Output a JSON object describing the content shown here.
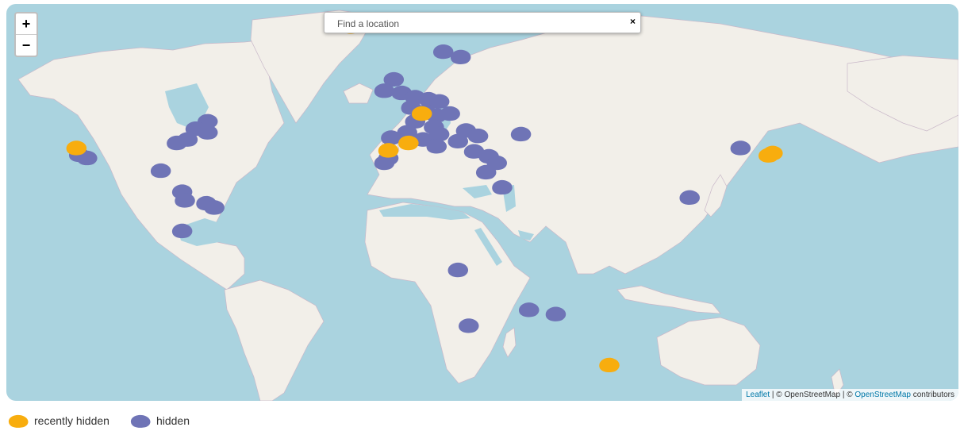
{
  "map": {
    "zoom_in_label": "+",
    "zoom_out_label": "−",
    "search": {
      "placeholder": "Find a location",
      "value": "",
      "clear_label": "×"
    },
    "attribution": {
      "leaflet": "Leaflet",
      "sep1": " | © OpenStreetMap | © ",
      "osm": "OpenStreetMap",
      "suffix": " contributors"
    },
    "colors": {
      "water": "#aad3df",
      "land": "#f2efe9",
      "recent": "#f8ad0e",
      "hidden": "#6f74b6"
    }
  },
  "legend": [
    {
      "label": "recently hidden",
      "color": "#f8ad0e",
      "icon": "blob-icon"
    },
    {
      "label": "hidden",
      "color": "#6f74b6",
      "icon": "blob-icon"
    }
  ],
  "markers": {
    "recent": [
      {
        "lat": 64.8,
        "lon": -19.0
      },
      {
        "lat": 37.5,
        "lon": -121.5
      },
      {
        "lat": 36.8,
        "lon": -5.0
      },
      {
        "lat": 39.0,
        "lon": 2.5
      },
      {
        "lat": 36.0,
        "lon": 138.5
      },
      {
        "lat": 35.3,
        "lon": 137.0
      },
      {
        "lat": -37.5,
        "lon": 77.5
      },
      {
        "lat": 47.0,
        "lon": 7.5
      }
    ],
    "hidden": [
      {
        "lat": 69.3,
        "lon": 22.5
      },
      {
        "lat": 70.5,
        "lon": 27.0
      },
      {
        "lat": 68.6,
        "lon": 19.0
      },
      {
        "lat": 60.5,
        "lon": 15.5
      },
      {
        "lat": 59.5,
        "lon": 22.0
      },
      {
        "lat": 55.0,
        "lon": -3.0
      },
      {
        "lat": 52.5,
        "lon": -6.5
      },
      {
        "lat": 52.0,
        "lon": 0.0
      },
      {
        "lat": 51.0,
        "lon": 5.0
      },
      {
        "lat": 50.5,
        "lon": 10.0
      },
      {
        "lat": 50.0,
        "lon": 14.0
      },
      {
        "lat": 48.5,
        "lon": 3.5
      },
      {
        "lat": 47.5,
        "lon": 9.0
      },
      {
        "lat": 46.5,
        "lon": 13.0
      },
      {
        "lat": 47.0,
        "lon": 18.0
      },
      {
        "lat": 45.0,
        "lon": 5.0
      },
      {
        "lat": 43.5,
        "lon": 12.0
      },
      {
        "lat": 42.0,
        "lon": 2.0
      },
      {
        "lat": 40.5,
        "lon": -4.0
      },
      {
        "lat": 40.0,
        "lon": 8.0
      },
      {
        "lat": 41.5,
        "lon": 14.0
      },
      {
        "lat": 38.0,
        "lon": 13.0
      },
      {
        "lat": 39.5,
        "lon": 21.0
      },
      {
        "lat": 42.5,
        "lon": 24.0
      },
      {
        "lat": 41.0,
        "lon": 28.5
      },
      {
        "lat": 41.5,
        "lon": 44.5
      },
      {
        "lat": 36.5,
        "lon": 27.0
      },
      {
        "lat": 35.0,
        "lon": 32.5
      },
      {
        "lat": 33.0,
        "lon": 35.5
      },
      {
        "lat": 30.0,
        "lon": 31.5
      },
      {
        "lat": 25.0,
        "lon": 37.5
      },
      {
        "lat": 34.5,
        "lon": -5.0
      },
      {
        "lat": 33.0,
        "lon": -6.5
      },
      {
        "lat": 45.0,
        "lon": -72.5
      },
      {
        "lat": 43.0,
        "lon": -77.0
      },
      {
        "lat": 42.0,
        "lon": -72.5
      },
      {
        "lat": 40.0,
        "lon": -80.0
      },
      {
        "lat": 39.0,
        "lon": -84.0
      },
      {
        "lat": 35.5,
        "lon": -120.5
      },
      {
        "lat": 34.5,
        "lon": -117.5
      },
      {
        "lat": 30.5,
        "lon": -90.0
      },
      {
        "lat": 23.5,
        "lon": -82.0
      },
      {
        "lat": 20.5,
        "lon": -81.0
      },
      {
        "lat": 19.5,
        "lon": -73.0
      },
      {
        "lat": 18.0,
        "lon": -70.0
      },
      {
        "lat": 9.5,
        "lon": -82.0
      },
      {
        "lat": 37.5,
        "lon": 126.5
      },
      {
        "lat": 21.5,
        "lon": 107.5
      },
      {
        "lat": -5.0,
        "lon": 21.0
      },
      {
        "lat": -19.5,
        "lon": 47.5
      },
      {
        "lat": -21.0,
        "lon": 57.5
      },
      {
        "lat": -25.0,
        "lon": 25.0
      }
    ]
  }
}
